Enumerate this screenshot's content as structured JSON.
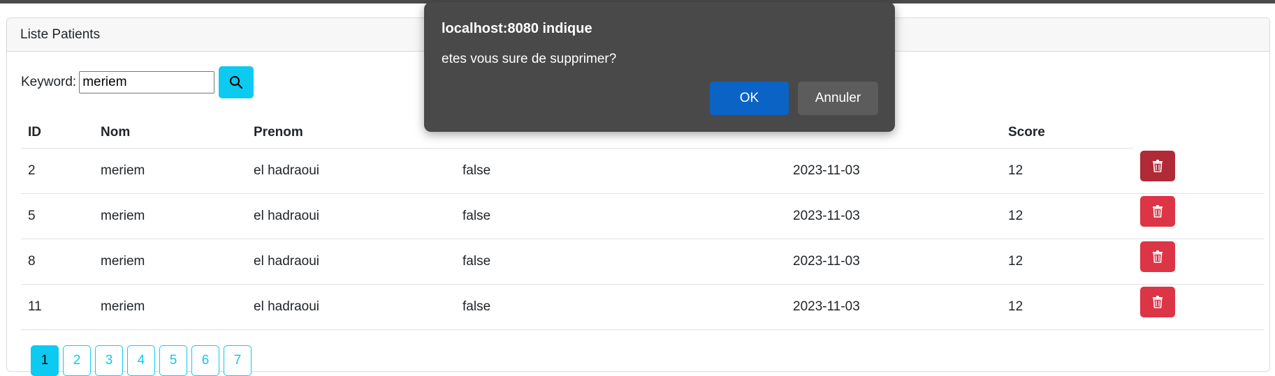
{
  "card": {
    "title": "Liste Patients"
  },
  "search": {
    "label": "Keyword:",
    "value": "meriem"
  },
  "table": {
    "headers": [
      "ID",
      "Nom",
      "Prenom",
      "",
      "",
      "Score"
    ],
    "rows": [
      [
        "2",
        "meriem",
        "el hadraoui",
        "false",
        "2023-11-03",
        "12"
      ],
      [
        "5",
        "meriem",
        "el hadraoui",
        "false",
        "2023-11-03",
        "12"
      ],
      [
        "8",
        "meriem",
        "el hadraoui",
        "false",
        "2023-11-03",
        "12"
      ],
      [
        "11",
        "meriem",
        "el hadraoui",
        "false",
        "2023-11-03",
        "12"
      ]
    ]
  },
  "pagination": {
    "pages": [
      "1",
      "2",
      "3",
      "4",
      "5",
      "6",
      "7"
    ],
    "current": "1"
  },
  "dialog": {
    "title": "localhost:8080 indique",
    "message": "etes vous sure de supprimer?",
    "ok_label": "OK",
    "cancel_label": "Annuler"
  },
  "colors": {
    "accent": "#0dcaf0",
    "danger": "#dc3545",
    "dialog_bg": "#494949",
    "dialog_ok": "#0b63c5"
  },
  "icons": {
    "search": "search-icon",
    "delete": "trash-icon"
  }
}
